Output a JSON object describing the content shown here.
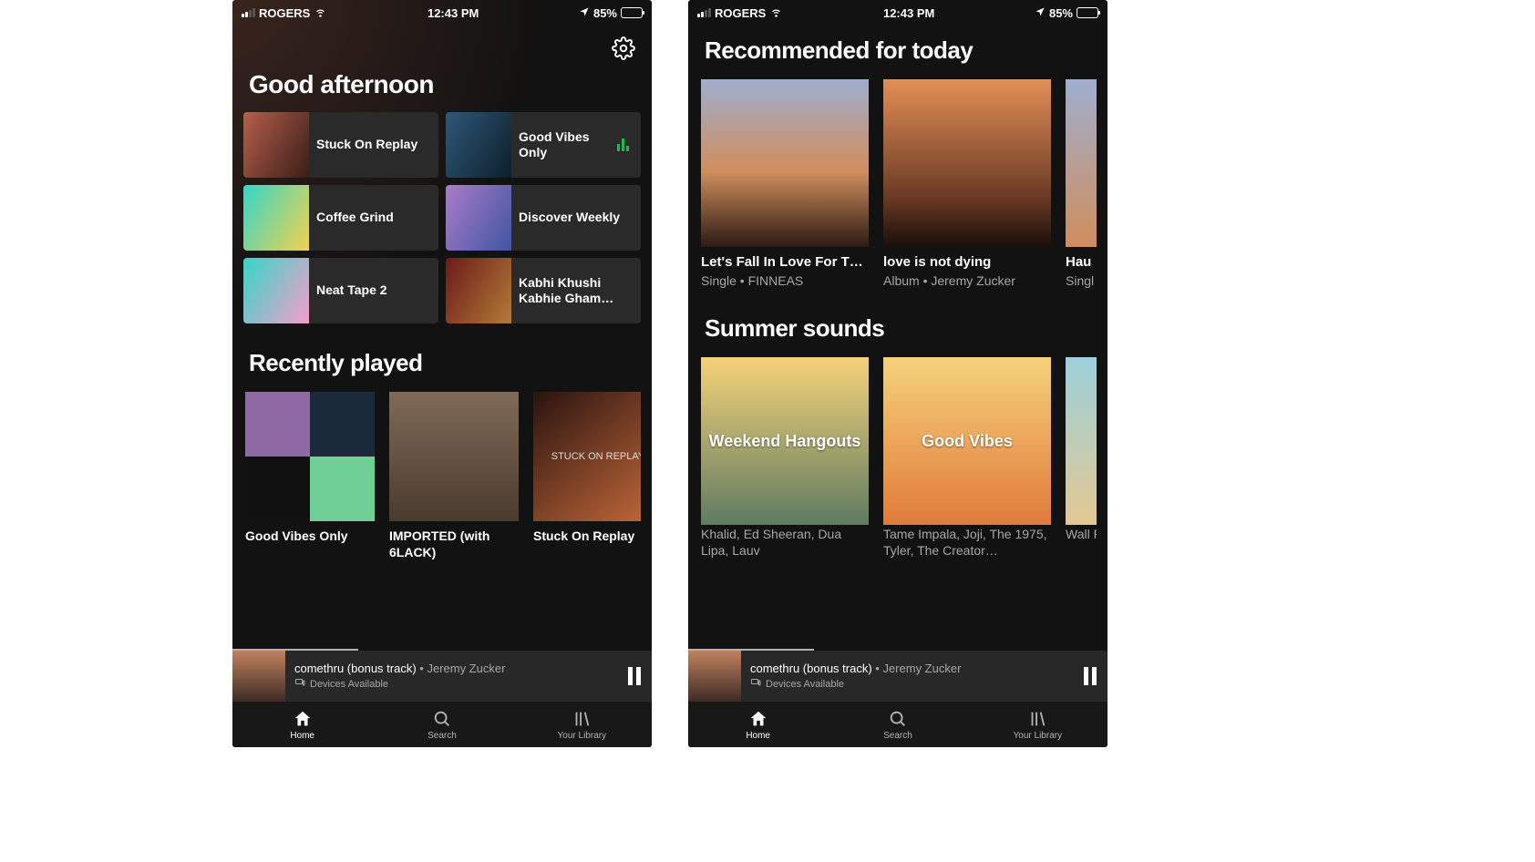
{
  "statusbar": {
    "carrier": "ROGERS",
    "time": "12:43 PM",
    "battery": "85%"
  },
  "left": {
    "greeting": "Good afternoon",
    "shortcuts": [
      {
        "label": "Stuck On Replay",
        "playing": false
      },
      {
        "label": "Good Vibes Only",
        "playing": true
      },
      {
        "label": "Coffee Grind",
        "playing": false
      },
      {
        "label": "Discover Weekly",
        "playing": false
      },
      {
        "label": "Neat Tape 2",
        "playing": false
      },
      {
        "label": "Kabhi Khushi Kabhie Gham…",
        "playing": false
      }
    ],
    "recent_heading": "Recently played",
    "recent": [
      {
        "title": "Good Vibes Only"
      },
      {
        "title": "IMPORTED (with 6LACK)"
      },
      {
        "title": "Stuck On Replay"
      }
    ]
  },
  "right": {
    "rec_heading": "Recommended for today",
    "rec": [
      {
        "title": "Let's Fall In Love For T…",
        "sub": "Single • FINNEAS"
      },
      {
        "title": "love is not dying",
        "sub": "Album • Jeremy Zucker"
      },
      {
        "title": "Hau",
        "sub": "Singl"
      }
    ],
    "summer_heading": "Summer sounds",
    "summer": [
      {
        "overlay": "Weekend Hangouts",
        "sub": "Khalid, Ed Sheeran, Dua Lipa, Lauv"
      },
      {
        "overlay": "Good Vibes",
        "sub": "Tame Impala, Joji, The 1975, Tyler, The Creator…"
      },
      {
        "overlay": "",
        "sub": "Wall Pilot"
      }
    ]
  },
  "nowplaying": {
    "track": "comethru (bonus track)",
    "artist": "Jeremy Zucker",
    "devices": "Devices Available"
  },
  "tabs": {
    "home": "Home",
    "search": "Search",
    "library": "Your Library"
  }
}
